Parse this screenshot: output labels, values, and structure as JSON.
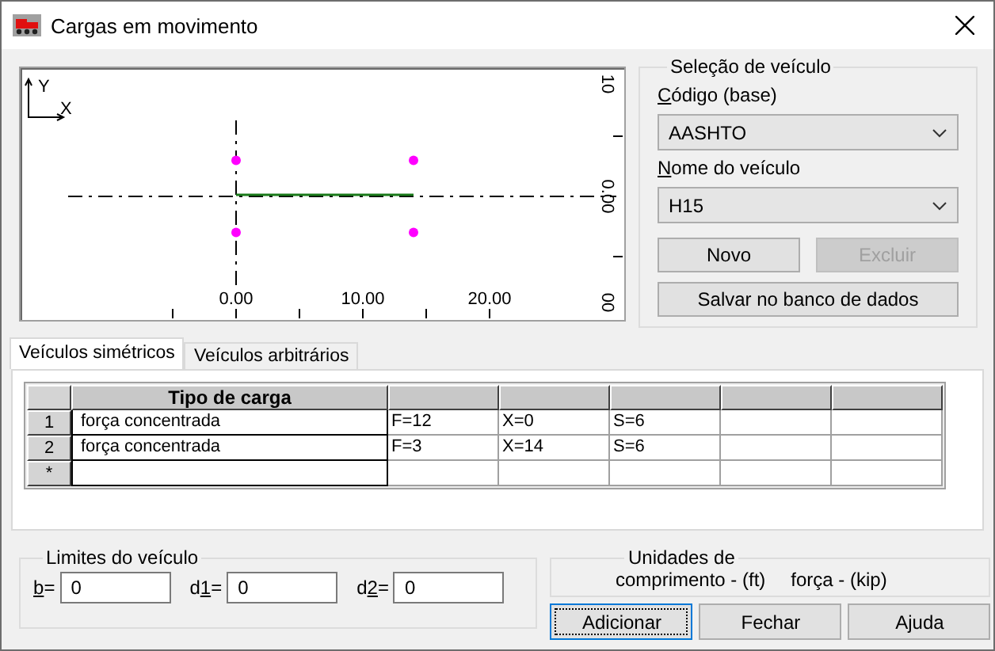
{
  "window": {
    "title": "Cargas em movimento"
  },
  "preview": {
    "axis_labels": [
      "Y",
      "X"
    ],
    "x_scale": [
      "0.00",
      "10.00",
      "20.00"
    ],
    "y_scale": [
      "10",
      "0.00",
      "00"
    ]
  },
  "vehicle_selection": {
    "title": "Seleção de veículo",
    "code_label": "Código (base)",
    "code": {
      "value": "AASHTO"
    },
    "name_label": "Nome do veículo",
    "name": {
      "value": "H15"
    },
    "buttons": [
      {
        "label": "Novo",
        "disabled": false
      },
      {
        "label": "Excluir",
        "disabled": true
      },
      {
        "label": "Salvar no banco de dados",
        "disabled": false
      }
    ]
  },
  "tabs": [
    {
      "label": "Veículos simétricos",
      "selected": true
    },
    {
      "label": "Veículos arbitrários",
      "selected": false
    }
  ],
  "table": {
    "columns": [
      "Tipo de carga"
    ],
    "rows": [
      {
        "header": "1",
        "cells": [
          "força concentrada",
          "F=12",
          "X=0",
          "S=6"
        ]
      },
      {
        "header": "2",
        "cells": [
          "força concentrada",
          "F=3",
          "X=14",
          "S=6"
        ]
      },
      {
        "header": "*"
      }
    ]
  },
  "limits": {
    "title": "Limites do veículo",
    "fields": [
      {
        "label": "b=",
        "value": "0"
      },
      {
        "label": "d1=",
        "value": "0"
      },
      {
        "label": "d2=",
        "value": "0"
      }
    ]
  },
  "units": {
    "title": "Unidades de",
    "length": "comprimento - (ft)",
    "force": "força - (kip)"
  },
  "buttons": [
    {
      "label": "Adicionar",
      "default": true
    },
    {
      "label": "Fechar",
      "default": false
    },
    {
      "label": "Ajuda",
      "default": false
    }
  ]
}
